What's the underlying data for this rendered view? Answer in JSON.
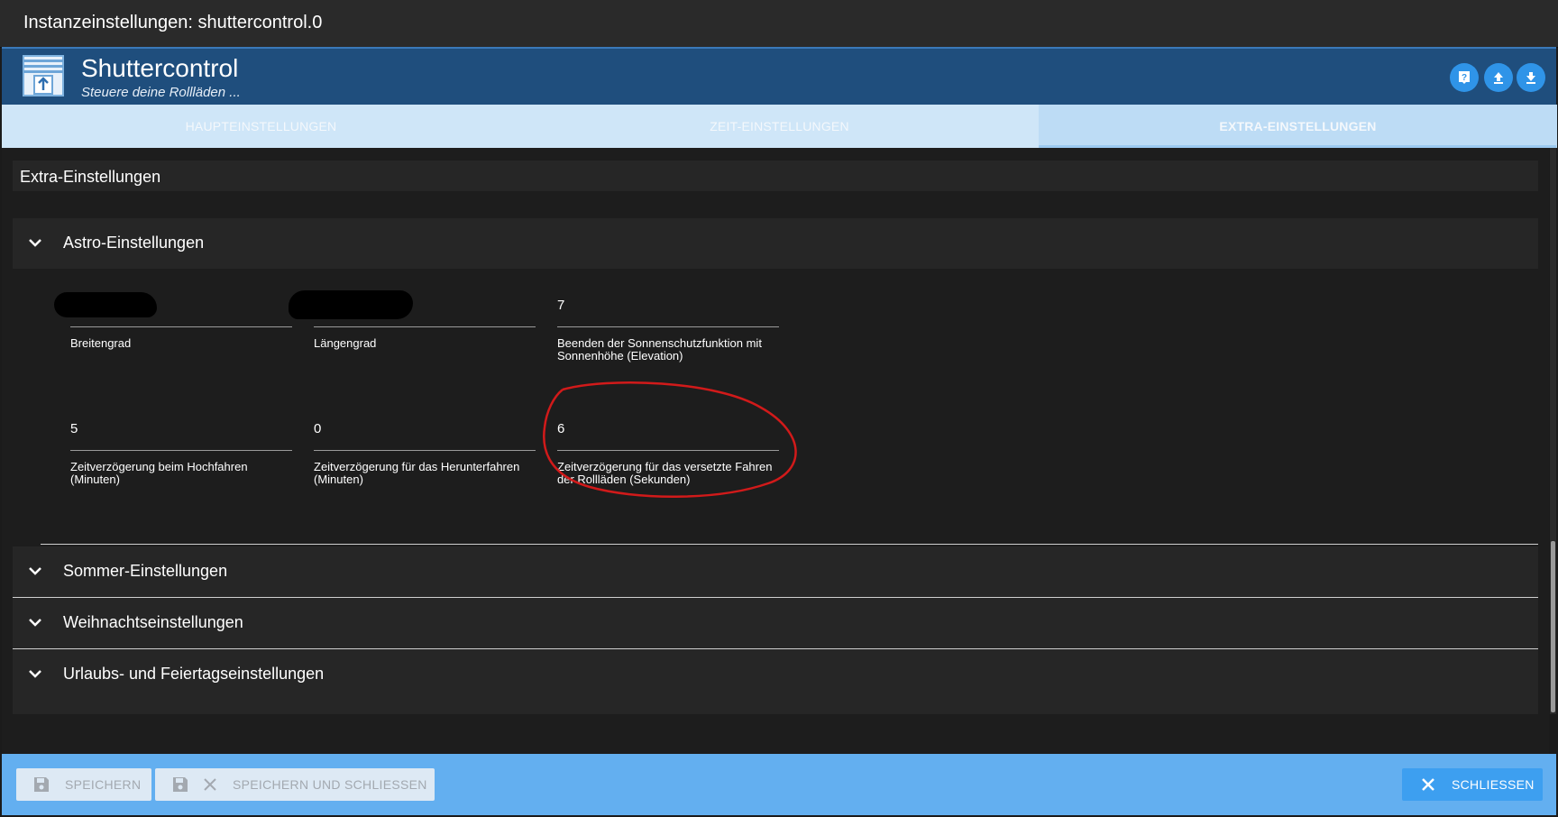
{
  "window": {
    "title": "Instanzeinstellungen: shuttercontrol.0"
  },
  "header": {
    "app_title": "Shuttercontrol",
    "app_subtitle": "Steuere deine Rollläden ...",
    "buttons": [
      "help-icon",
      "upload-icon",
      "download-icon"
    ]
  },
  "tabs": [
    {
      "label": "HAUPTEINSTELLUNGEN"
    },
    {
      "label": "ZEIT-EINSTELLUNGEN"
    },
    {
      "label": "EXTRA-EINSTELLUNGEN",
      "active": true
    }
  ],
  "section": {
    "title": "Extra-Einstellungen"
  },
  "panels": {
    "astro": "Astro-Einstellungen",
    "sommer": "Sommer-Einstellungen",
    "weihnacht": "Weihnachtseinstellungen",
    "urlaub": "Urlaubs- und Feiertagseinstellungen"
  },
  "astro_fields": [
    {
      "value": "",
      "label": "Breitengrad",
      "redacted": true
    },
    {
      "value": "",
      "label": "Längengrad",
      "redacted": true
    },
    {
      "value": "7",
      "label": "Beenden der Sonnenschutzfunktion mit Sonnenhöhe (Elevation)"
    },
    {
      "value": "5",
      "label": "Zeitverzögerung beim Hochfahren (Minuten)"
    },
    {
      "value": "0",
      "label": "Zeitverzögerung für das Herunterfahren (Minuten)"
    },
    {
      "value": "6",
      "label": "Zeitverzögerung für das versetzte Fahren der Rollläden (Sekunden)",
      "highlighted": true
    }
  ],
  "footer": {
    "save": "SPEICHERN",
    "save_close": "SPEICHERN UND SCHLIESSEN",
    "close": "SCHLIESSEN"
  },
  "colors": {
    "header_bg": "#1f4e7d",
    "tabs_bg": "#cfe6f8",
    "footer_bg": "#63aff0",
    "accent_button": "#2f94e8",
    "highlight_circle": "#d11a1a"
  }
}
